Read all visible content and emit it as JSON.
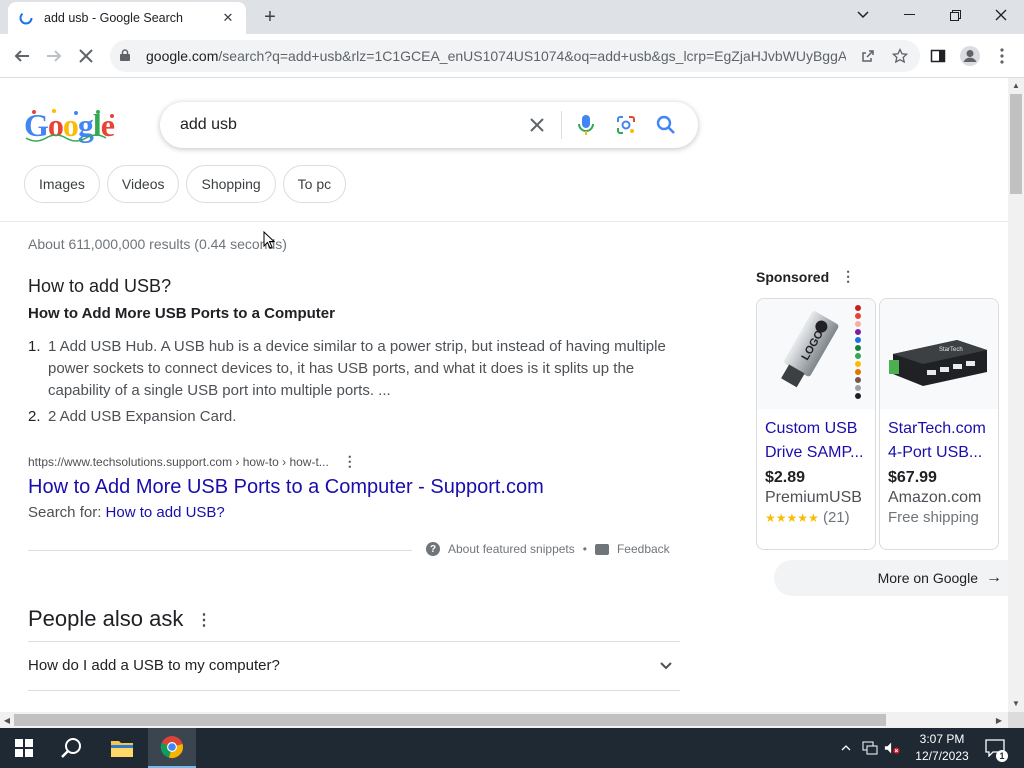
{
  "browser": {
    "tab_title": "add usb - Google Search",
    "url_host": "google.com",
    "url_rest": "/search?q=add+usb&rlz=1C1GCEA_enUS1074US1074&oq=add+usb&gs_lcrp=EgZjaHJvbWUyBggA..."
  },
  "search": {
    "query": "add usb",
    "chips": [
      "Images",
      "Videos",
      "Shopping",
      "To pc"
    ],
    "stats": "About 611,000,000 results (0.44 seconds)"
  },
  "snippet": {
    "question": "How to add USB?",
    "heading": "How to Add More USB Ports to a Computer",
    "items": [
      {
        "num": "1.",
        "text": "1 Add USB Hub. A USB hub is a device similar to a power strip, but instead of having multiple power sockets to connect devices to, it has USB ports, and what it does is it splits up the capability of a single USB port into multiple ports. ..."
      },
      {
        "num": "2.",
        "text": "2 Add USB Expansion Card."
      }
    ],
    "cite": "https://www.techsolutions.support.com › how-to › how-t...",
    "link_title": "How to Add More USB Ports to a Computer - Support.com",
    "search_for_label": "Search for:",
    "search_for_link": "How to add USB?",
    "about_label": "About featured snippets",
    "feedback_label": "Feedback"
  },
  "paa": {
    "title": "People also ask",
    "questions": [
      "How do I add a USB to my computer?"
    ]
  },
  "sponsored": {
    "label": "Sponsored",
    "products": [
      {
        "name": "Custom USB Drive SAMP...",
        "price": "$2.89",
        "store": "PremiumUSB",
        "rating": 5,
        "reviews": "(21)"
      },
      {
        "name": "StarTech.com 4-Port USB...",
        "price": "$67.99",
        "store": "Amazon.com",
        "extra": "Free shipping"
      }
    ],
    "more_label": "More on Google"
  },
  "taskbar": {
    "time": "3:07 PM",
    "date": "12/7/2023",
    "notif_count": "1"
  },
  "colors": {
    "link": "#1a0dab",
    "accent_blue": "#4285f4",
    "taskbar_bg": "#1f2933"
  }
}
